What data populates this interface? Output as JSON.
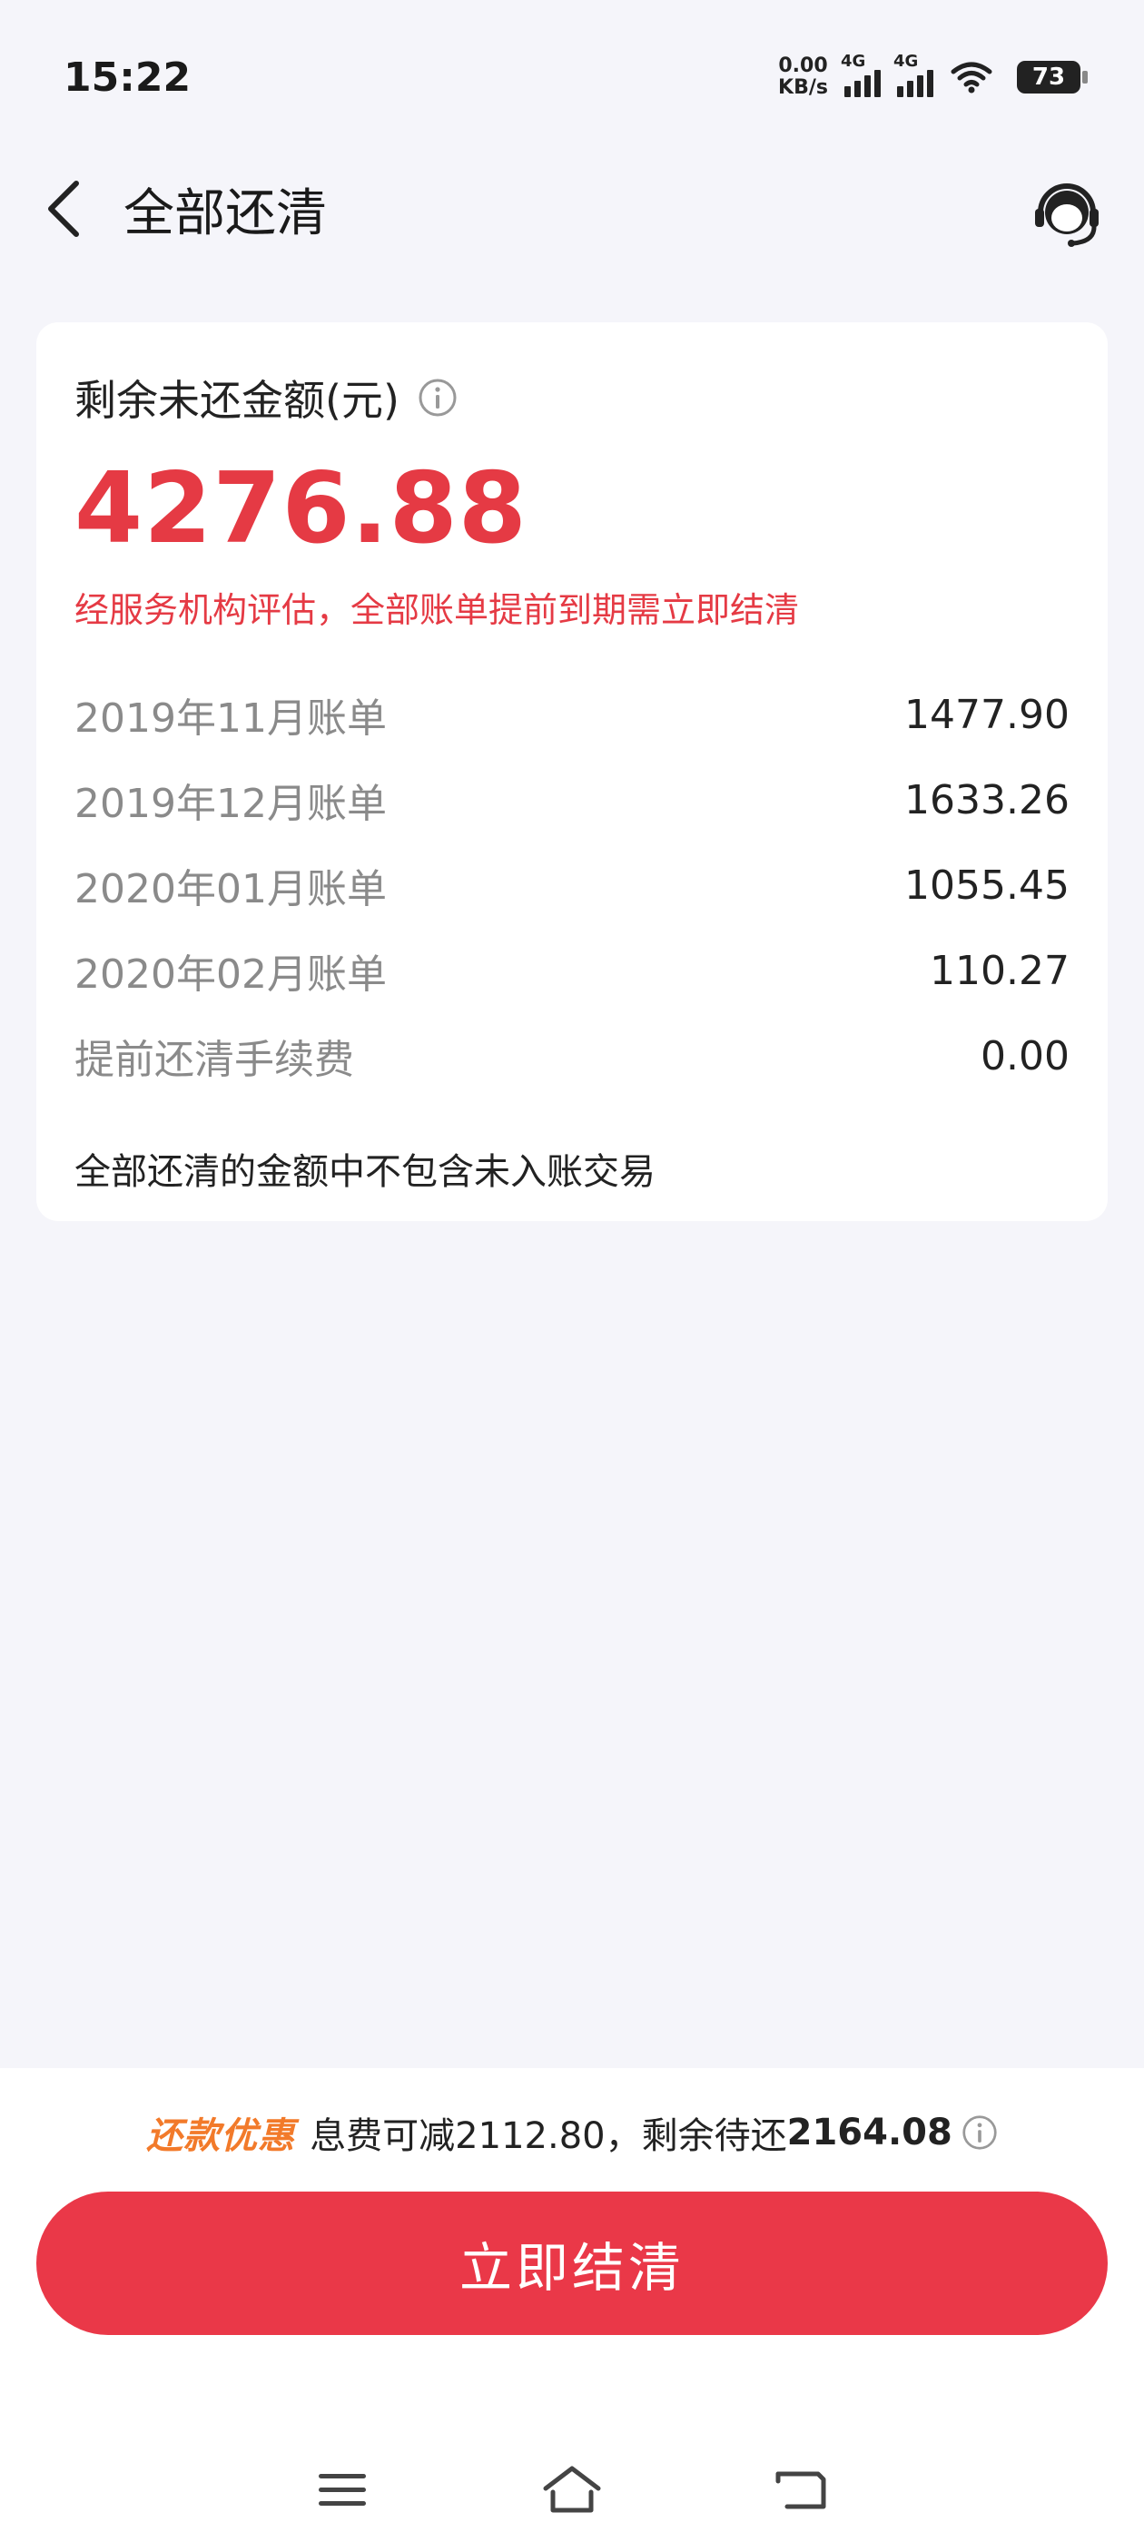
{
  "status_bar": {
    "time": "15:22",
    "net_speed_value": "0.00",
    "net_speed_unit": "KB/s",
    "signal1_label": "4G",
    "signal2_label": "4G",
    "battery": "73"
  },
  "header": {
    "title": "全部还清"
  },
  "summary": {
    "label": "剩余未还金额(元)",
    "amount": "4276.88",
    "warning": "经服务机构评估，全部账单提前到期需立即结清",
    "bills": [
      {
        "name": "2019年11月账单",
        "value": "1477.90"
      },
      {
        "name": "2019年12月账单",
        "value": "1633.26"
      },
      {
        "name": "2020年01月账单",
        "value": "1055.45"
      },
      {
        "name": "2020年02月账单",
        "value": "110.27"
      },
      {
        "name": "提前还清手续费",
        "value": "0.00"
      }
    ],
    "note": "全部还清的金额中不包含未入账交易"
  },
  "footer": {
    "promo_tag": "还款优惠",
    "promo_text_1": "息费可减2112.80，剩余待还",
    "promo_amount": "2164.08",
    "settle_label": "立即结清"
  },
  "colors": {
    "accent": "#e53a44",
    "button": "#ea3848",
    "promo": "#f27a2a",
    "background": "#f5f5fa"
  }
}
